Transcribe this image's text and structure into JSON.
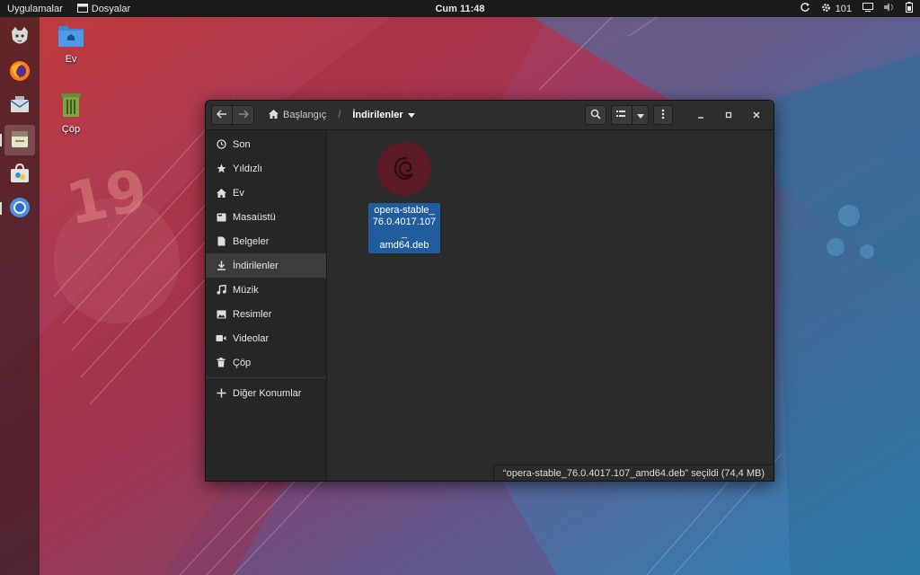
{
  "topbar": {
    "apps_label": "Uygulamalar",
    "files_label": "Dosyalar",
    "clock": "Cum 11:48",
    "counter": "101"
  },
  "dock": {
    "items": [
      {
        "name": "pardus-logo-icon"
      },
      {
        "name": "firefox-icon"
      },
      {
        "name": "mail-icon"
      },
      {
        "name": "files-icon",
        "active": true
      },
      {
        "name": "software-store-icon"
      },
      {
        "name": "chromium-icon"
      }
    ]
  },
  "desktop": {
    "home_label": "Ev",
    "trash_label": "Çöp",
    "wallpaper_text": "19"
  },
  "window": {
    "breadcrumb": {
      "home": "Başlangıç",
      "separator": "/",
      "current": "İndirilenler"
    },
    "sidebar": {
      "items": [
        {
          "label": "Son",
          "icon": "clock-icon"
        },
        {
          "label": "Yıldızlı",
          "icon": "star-icon"
        },
        {
          "label": "Ev",
          "icon": "home-icon"
        },
        {
          "label": "Masaüstü",
          "icon": "desktop-icon"
        },
        {
          "label": "Belgeler",
          "icon": "document-icon"
        },
        {
          "label": "İndirilenler",
          "icon": "download-icon",
          "selected": true
        },
        {
          "label": "Müzik",
          "icon": "music-icon"
        },
        {
          "label": "Resimler",
          "icon": "pictures-icon"
        },
        {
          "label": "Videolar",
          "icon": "video-icon"
        },
        {
          "label": "Çöp",
          "icon": "trash-icon"
        }
      ],
      "other_locations": "Diğer Konumlar"
    },
    "file": {
      "name": "opera-stable_76.0.4017.107_amd64.deb",
      "display_lines": [
        "opera-stable_",
        "76.0.4017.107_",
        "amd64.deb"
      ]
    },
    "status": "“opera-stable_76.0.4017.107_amd64.deb” seçildi  (74,4 MB)"
  },
  "colors": {
    "selection": "#215d9c",
    "window_bg": "#2b2b2b",
    "debian_red": "#5c1a24"
  }
}
